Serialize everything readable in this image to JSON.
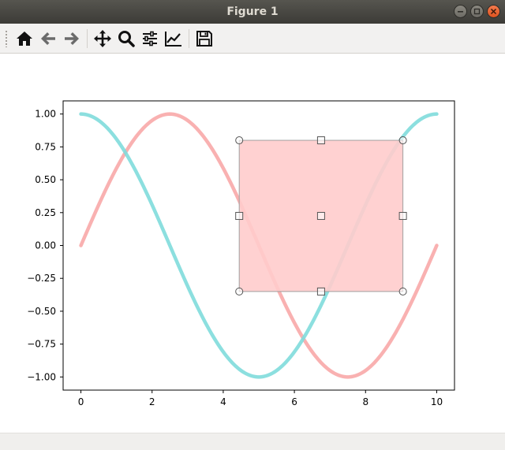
{
  "window": {
    "title": "Figure 1"
  },
  "toolbar": {
    "tools": [
      {
        "name": "home-icon",
        "tooltip": "Reset original view"
      },
      {
        "name": "back-icon",
        "tooltip": "Back to previous view"
      },
      {
        "name": "forward-icon",
        "tooltip": "Forward to next view"
      },
      {
        "name": "pan-icon",
        "tooltip": "Pan axes"
      },
      {
        "name": "zoom-icon",
        "tooltip": "Zoom to rectangle"
      },
      {
        "name": "subplots-icon",
        "tooltip": "Configure subplots"
      },
      {
        "name": "edit-axes-icon",
        "tooltip": "Edit axis"
      },
      {
        "name": "save-icon",
        "tooltip": "Save the figure"
      }
    ]
  },
  "statusbar": {
    "text": ""
  },
  "colors": {
    "sin_line": "#f8a9a9",
    "cos_line": "#7fdcdc",
    "selector_fill": "#ffcccc",
    "selector_edge": "#a0a0a0",
    "handle_edge": "#555555"
  },
  "chart_data": {
    "type": "line",
    "title": "",
    "xlabel": "",
    "ylabel": "",
    "xlim": [
      -0.5,
      10.5
    ],
    "ylim": [
      -1.1,
      1.1
    ],
    "xticks": [
      0,
      2,
      4,
      6,
      8,
      10
    ],
    "xtick_labels": [
      "0",
      "2",
      "4",
      "6",
      "8",
      "10"
    ],
    "yticks": [
      1.0,
      0.75,
      0.5,
      0.25,
      0.0,
      -0.25,
      -0.5,
      -0.75,
      -1.0
    ],
    "ytick_labels": [
      "1.00",
      "0.75",
      "0.50",
      "0.25",
      "0.00",
      "−0.25",
      "−0.50",
      "−0.75",
      "−1.00"
    ],
    "grid": false,
    "series": [
      {
        "function": "sin(2*pi*x/10)",
        "x_range": [
          0,
          10
        ],
        "color": "#f8a9a9",
        "alpha": 0.9
      },
      {
        "function": "cos(2*pi*x/10)",
        "x_range": [
          0,
          10
        ],
        "color": "#7fdcdc",
        "alpha": 0.9
      }
    ],
    "rectangle_selector": {
      "x0": 4.45,
      "x1": 9.05,
      "y0": -0.35,
      "y1": 0.8,
      "corner_handles": "circle",
      "edge_handles": "square",
      "center_handle": "square"
    }
  }
}
